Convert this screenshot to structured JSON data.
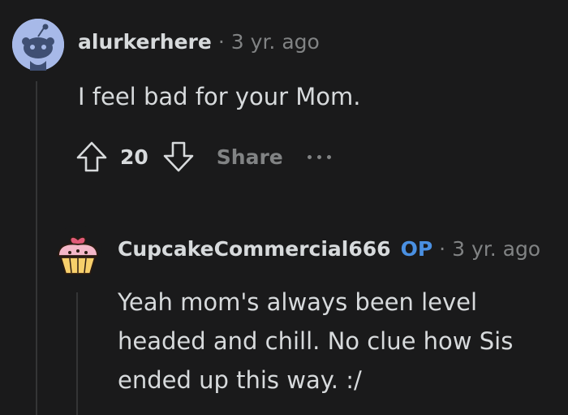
{
  "comments": [
    {
      "username": "alurkerhere",
      "separator": "·",
      "time": "3 yr. ago",
      "body": "I feel bad for your Mom.",
      "votes": "20",
      "share_label": "Share",
      "avatar_icon": "snoo-avatar-icon"
    },
    {
      "username": "CupcakeCommercial666",
      "op_badge": "OP",
      "separator": "·",
      "time": "3 yr. ago",
      "body_lines": [
        "Yeah mom's always been level",
        "headed and chill. No clue how Sis",
        "ended up this way. :/"
      ],
      "avatar_icon": "cupcake-avatar-icon"
    }
  ],
  "colors": {
    "background": "#1a1a1b",
    "text": "#d7dadc",
    "muted": "#818384",
    "op": "#4a90e2",
    "avatar_bg": "#a7b9e8"
  }
}
